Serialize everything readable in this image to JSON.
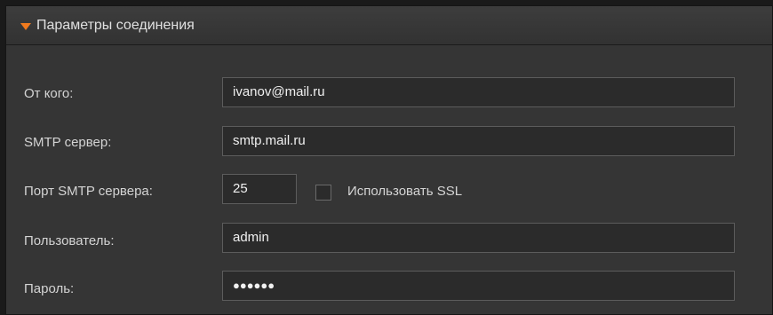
{
  "section": {
    "title": "Параметры соединения",
    "icon": "triangle-down-icon",
    "accent_color": "#f07a1e"
  },
  "fields": {
    "from": {
      "label": "От кого:",
      "value": "ivanov@mail.ru"
    },
    "smtp_server": {
      "label": "SMTP сервер:",
      "value": "smtp.mail.ru"
    },
    "smtp_port": {
      "label": "Порт SMTP сервера:",
      "value": "25"
    },
    "use_ssl": {
      "label": "Использовать SSL",
      "checked": false
    },
    "user": {
      "label": "Пользователь:",
      "value": "admin"
    },
    "password": {
      "label": "Пароль:",
      "value": "●●●●●●"
    }
  }
}
